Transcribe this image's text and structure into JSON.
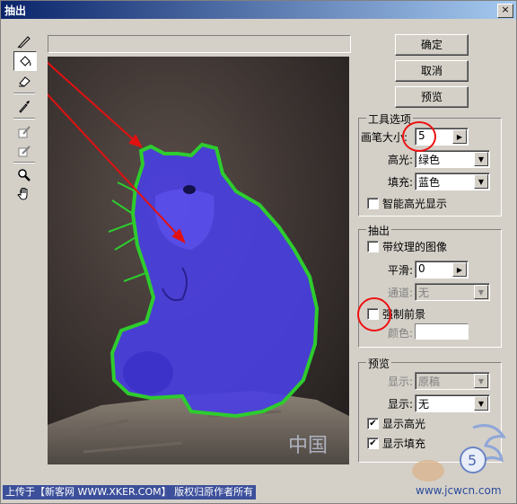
{
  "window": {
    "title": "抽出",
    "close_glyph": "×"
  },
  "buttons": {
    "ok": "确定",
    "cancel": "取消",
    "preview": "预览"
  },
  "tool_options": {
    "heading": "工具选项",
    "brush_size_label": "画笔大小:",
    "brush_size_value": "5",
    "highlight_label": "高光:",
    "highlight_value": "绿色",
    "fill_label": "填充:",
    "fill_value": "蓝色",
    "smart_highlight_label": "智能高光显示",
    "smart_highlight_checked": false
  },
  "extraction": {
    "heading": "抽出",
    "textured_image_label": "带纹理的图像",
    "smooth_label": "平滑:",
    "smooth_value": "0",
    "channel_label": "通道:",
    "channel_value": "无",
    "force_foreground_label": "强制前景",
    "color_label": "颜色:"
  },
  "preview": {
    "heading": "预览",
    "show_label": "显示:",
    "show_value": "原稿",
    "display_label": "显示:",
    "display_value": "无",
    "show_highlight_label": "显示高光",
    "show_highlight_checked": true,
    "show_fill_label": "显示填充",
    "show_fill_checked": true,
    "check_glyph": "✔"
  },
  "footer": {
    "text": "上传于【新客网 WWW.XKER.COM】 版权归原作者所有"
  },
  "watermark": {
    "text": "www.jcwcn.com",
    "cn": "中国"
  },
  "colors": {
    "highlight": "#2ecc2e",
    "fill": "#4a3fe0",
    "annotation": "#e11111"
  }
}
